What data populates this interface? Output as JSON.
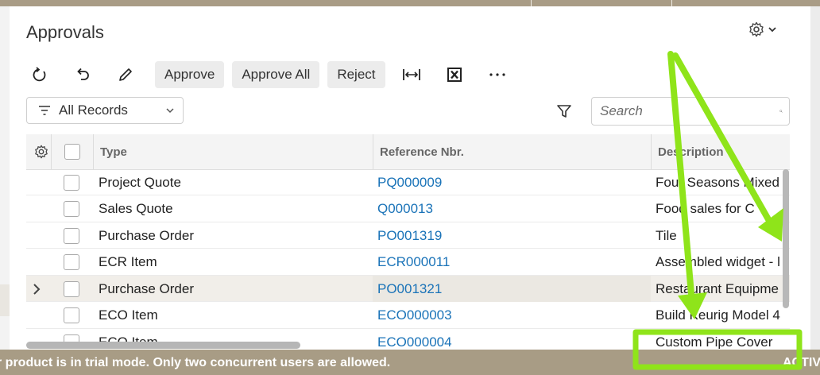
{
  "page": {
    "title": "Approvals"
  },
  "toolbar": {
    "refresh_icon": "refresh-icon",
    "undo_icon": "undo-icon",
    "edit_icon": "pencil-icon",
    "approve_label": "Approve",
    "approve_all_label": "Approve All",
    "reject_label": "Reject",
    "fit_columns_icon": "fit-columns-icon",
    "excel_icon": "excel-export-icon",
    "more_icon": "more-icon"
  },
  "filter": {
    "selected": "All Records"
  },
  "search": {
    "placeholder": "Search"
  },
  "grid": {
    "columns": [
      "Type",
      "Reference Nbr.",
      "Description"
    ],
    "rows": [
      {
        "type": "Project Quote",
        "ref": "PQ000009",
        "desc": "Four Seasons Mixed"
      },
      {
        "type": "Sales Quote",
        "ref": "Q000013",
        "desc": "Food sales for C"
      },
      {
        "type": "Purchase Order",
        "ref": "PO001319",
        "desc": "Tile"
      },
      {
        "type": "ECR Item",
        "ref": "ECR000011",
        "desc": "Assembled widget - l"
      },
      {
        "type": "Purchase Order",
        "ref": "PO001321",
        "desc": "Restaurant Equipme",
        "selected": true
      },
      {
        "type": "ECO Item",
        "ref": "ECO000003",
        "desc": "Build Keurig Model 4"
      },
      {
        "type": "ECO Item",
        "ref": "ECO000004",
        "desc": "Custom Pipe Cover"
      }
    ]
  },
  "banner": {
    "message": "r product is in trial mode. Only two concurrent users are allowed.",
    "right": "ACTIV"
  },
  "colors": {
    "link": "#1a73b8",
    "banner": "#a89c85",
    "highlight": "#8fe41a"
  }
}
